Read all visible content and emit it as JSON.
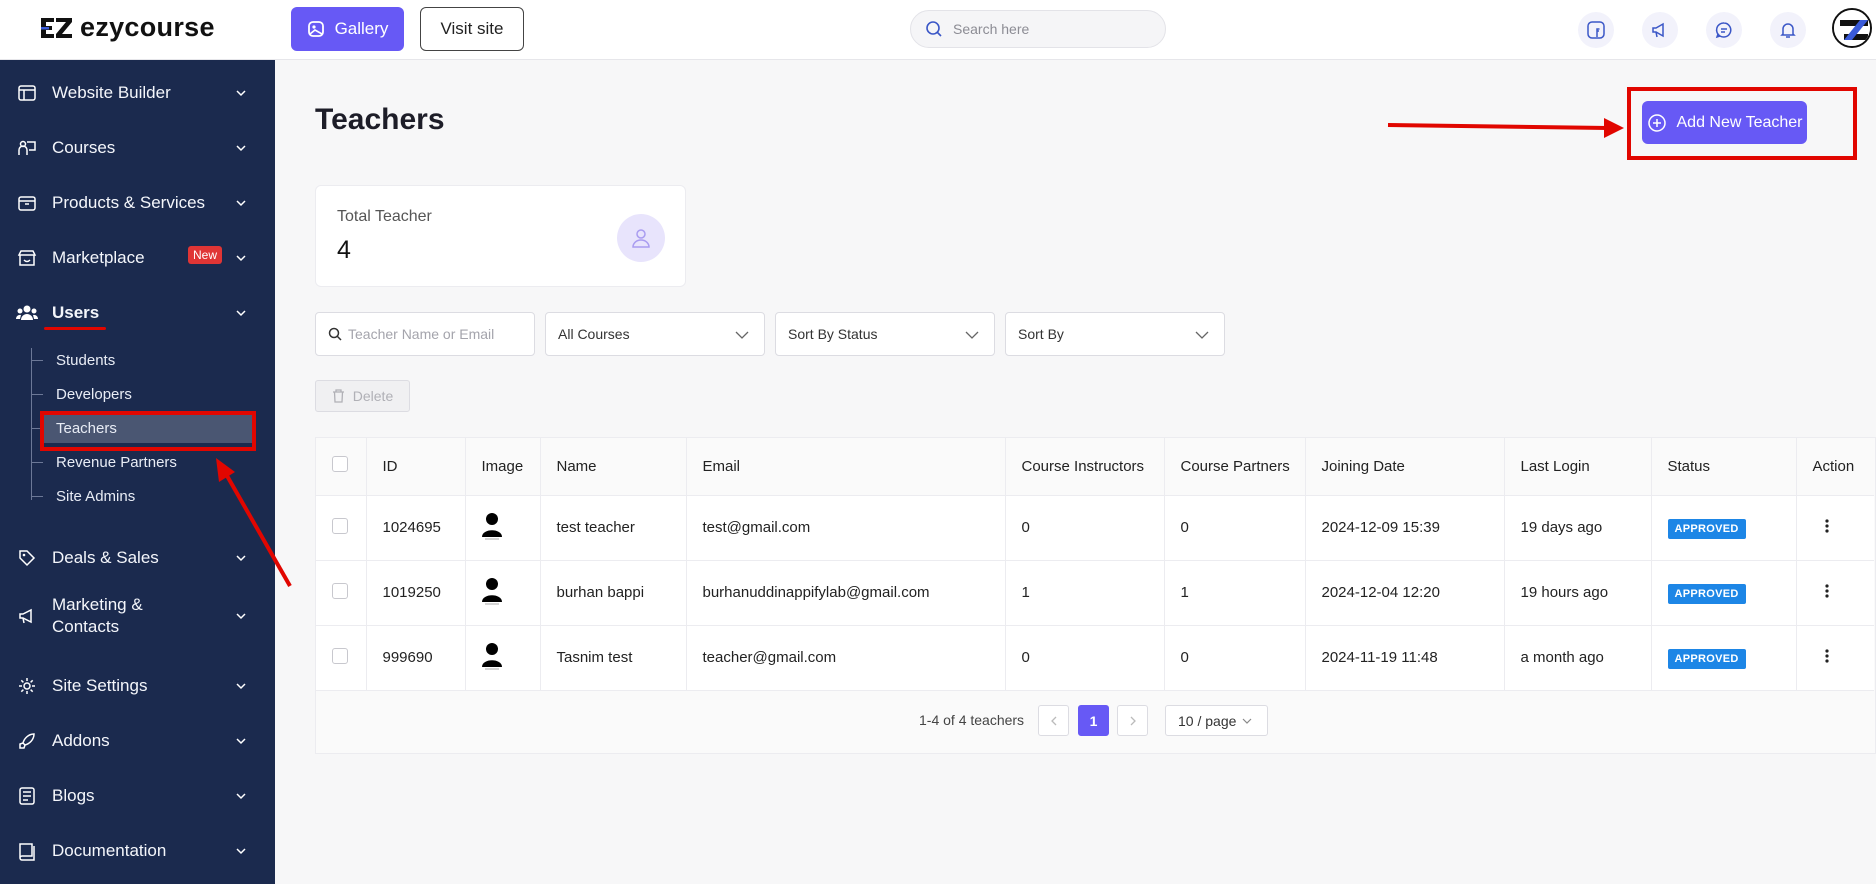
{
  "brand": {
    "name": "ezycourse"
  },
  "topbar": {
    "gallery_label": "Gallery",
    "visit_label": "Visit site",
    "search_placeholder": "Search here"
  },
  "sidebar": {
    "items": [
      {
        "label": "Website Builder",
        "icon": "layout-icon"
      },
      {
        "label": "Courses",
        "icon": "teacher-board-icon"
      },
      {
        "label": "Products & Services",
        "icon": "box-icon"
      },
      {
        "label": "Marketplace",
        "icon": "store-icon",
        "badge": "New"
      },
      {
        "label": "Users",
        "icon": "users-icon"
      },
      {
        "label": "Deals & Sales",
        "icon": "tag-icon"
      },
      {
        "label": "Marketing &",
        "label2": "Contacts",
        "icon": "megaphone-icon"
      },
      {
        "label": "Site Settings",
        "icon": "gear-icon"
      },
      {
        "label": "Addons",
        "icon": "rocket-icon"
      },
      {
        "label": "Blogs",
        "icon": "blog-icon"
      },
      {
        "label": "Documentation",
        "icon": "book-icon"
      }
    ],
    "users_sub": [
      "Students",
      "Developers",
      "Teachers",
      "Revenue Partners",
      "Site Admins"
    ]
  },
  "main": {
    "title": "Teachers",
    "add_button": "Add New Teacher",
    "stat": {
      "label": "Total Teacher",
      "value": "4"
    },
    "filters": {
      "search_placeholder": "Teacher Name or Email",
      "courses": "All Courses",
      "status": "Sort By Status",
      "sort": "Sort By"
    },
    "delete_label": "Delete",
    "table": {
      "headers": [
        "ID",
        "Image",
        "Name",
        "Email",
        "Course Instructors",
        "Course Partners",
        "Joining Date",
        "Last Login",
        "Status",
        "Action"
      ],
      "rows": [
        {
          "id": "1024695",
          "name": "test teacher",
          "email": "test@gmail.com",
          "instructors": "0",
          "partners": "0",
          "joined": "2024-12-09 15:39",
          "last_login": "19 days ago",
          "status": "APPROVED"
        },
        {
          "id": "1019250",
          "name": "burhan bappi",
          "email": "burhanuddinappifylab@gmail.com",
          "instructors": "1",
          "partners": "1",
          "joined": "2024-12-04 12:20",
          "last_login": "19 hours ago",
          "status": "APPROVED"
        },
        {
          "id": "999690",
          "name": "Tasnim test",
          "email": "teacher@gmail.com",
          "instructors": "0",
          "partners": "0",
          "joined": "2024-11-19 11:48",
          "last_login": "a month ago",
          "status": "APPROVED"
        }
      ]
    },
    "pagination": {
      "summary": "1-4 of 4 teachers",
      "current": "1",
      "page_size": "10 / page"
    }
  },
  "colors": {
    "accent": "#6759f5",
    "sidebar": "#1b2a4e",
    "annotation": "#e10600",
    "status": "#1d86e6"
  }
}
